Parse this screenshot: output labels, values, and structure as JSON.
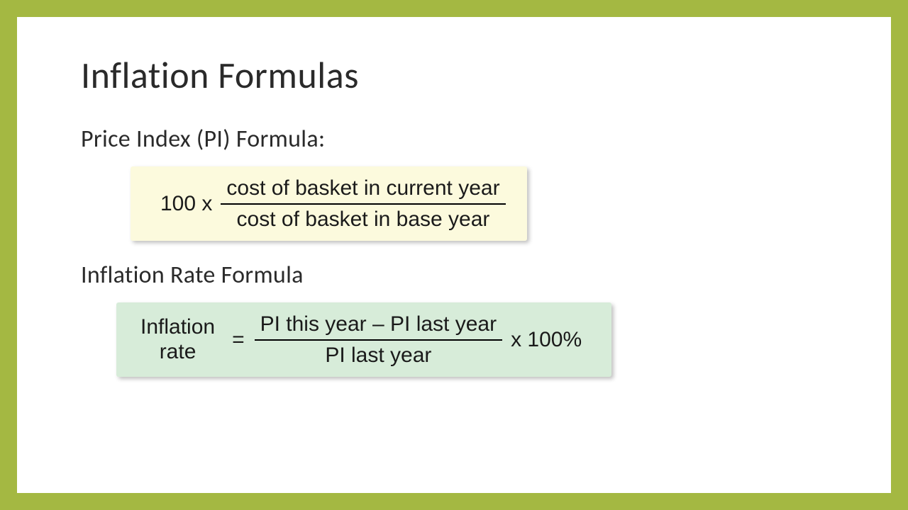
{
  "title": "Inflation Formulas",
  "sections": {
    "pi": {
      "heading": "Price Index (PI) Formula:",
      "prefix": "100 x",
      "numerator": "cost of basket in current year",
      "denominator": "cost of basket in base year"
    },
    "inflation": {
      "heading": "Inflation Rate Formula",
      "label_line1": "Inflation",
      "label_line2": "rate",
      "equals": "=",
      "numerator": "PI this year – PI last year",
      "denominator": "PI last year",
      "suffix": "x 100%"
    }
  }
}
